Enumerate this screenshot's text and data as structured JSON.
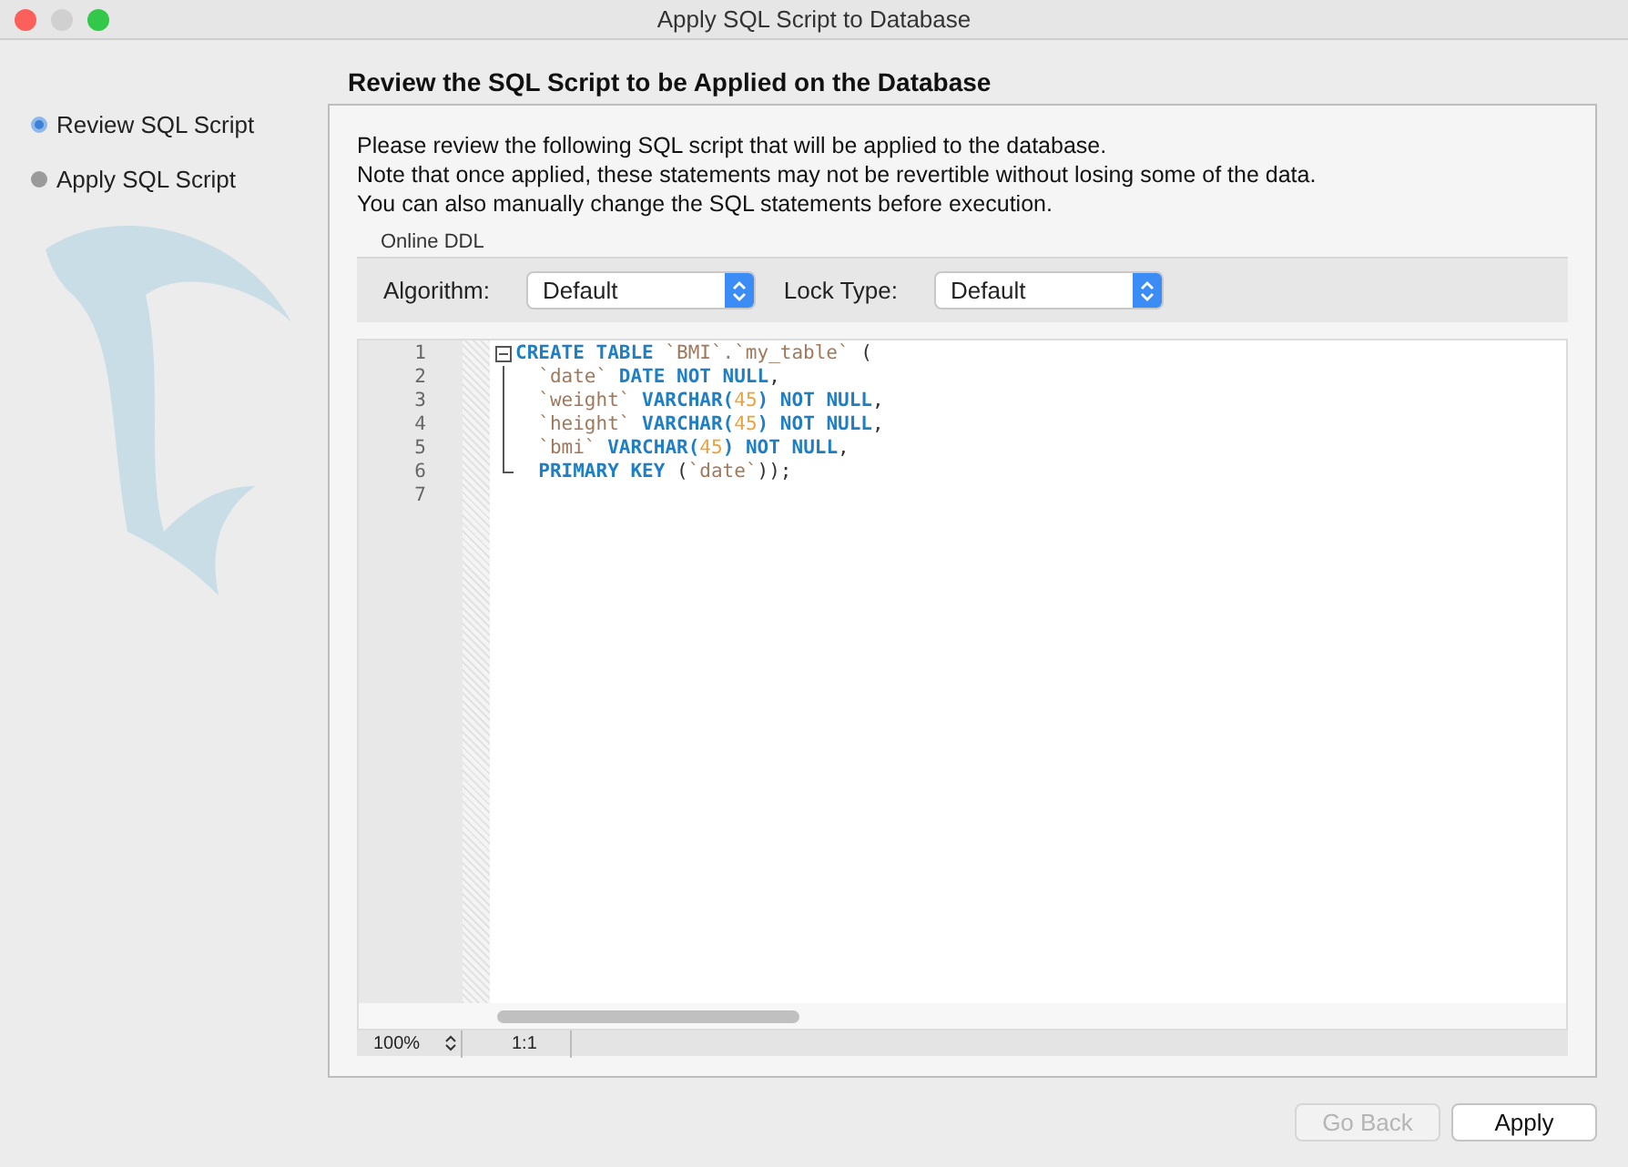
{
  "window": {
    "title": "Apply SQL Script to Database"
  },
  "steps": [
    {
      "label": "Review SQL Script",
      "selected": true
    },
    {
      "label": "Apply SQL Script",
      "selected": false
    }
  ],
  "heading": "Review the SQL Script to be Applied on the Database",
  "description": [
    "Please review the following SQL script that will be applied to the database.",
    "Note that once applied, these statements may not be revertible without losing some of the data.",
    "You can also manually change the SQL statements before execution."
  ],
  "online_ddl": {
    "title": "Online DDL",
    "algorithm": {
      "label": "Algorithm:",
      "value": "Default"
    },
    "lock_type": {
      "label": "Lock Type:",
      "value": "Default"
    }
  },
  "editor": {
    "lines": [
      {
        "number": "1",
        "kind": "open",
        "tokens": [
          {
            "kind": "keyword",
            "text": "CREATE TABLE"
          },
          {
            "kind": "ident",
            "text": " `BMI`.`my_table`"
          },
          {
            "kind": "plain",
            "text": " ("
          }
        ]
      },
      {
        "number": "2",
        "kind": "inner",
        "tokens": [
          {
            "kind": "ident",
            "text": "  `date`"
          },
          {
            "kind": "keyword",
            "text": " DATE NOT NULL"
          },
          {
            "kind": "plain",
            "text": ","
          }
        ]
      },
      {
        "number": "3",
        "kind": "inner",
        "tokens": [
          {
            "kind": "ident",
            "text": "  `weight`"
          },
          {
            "kind": "keyword",
            "text": " VARCHAR("
          },
          {
            "kind": "number",
            "text": "45"
          },
          {
            "kind": "keyword",
            "text": ") NOT NULL"
          },
          {
            "kind": "plain",
            "text": ","
          }
        ]
      },
      {
        "number": "4",
        "kind": "inner",
        "tokens": [
          {
            "kind": "ident",
            "text": "  `height`"
          },
          {
            "kind": "keyword",
            "text": " VARCHAR("
          },
          {
            "kind": "number",
            "text": "45"
          },
          {
            "kind": "keyword",
            "text": ") NOT NULL"
          },
          {
            "kind": "plain",
            "text": ","
          }
        ]
      },
      {
        "number": "5",
        "kind": "inner",
        "tokens": [
          {
            "kind": "ident",
            "text": "  `bmi`"
          },
          {
            "kind": "keyword",
            "text": " VARCHAR("
          },
          {
            "kind": "number",
            "text": "45"
          },
          {
            "kind": "keyword",
            "text": ") NOT NULL"
          },
          {
            "kind": "plain",
            "text": ","
          }
        ]
      },
      {
        "number": "6",
        "kind": "close",
        "tokens": [
          {
            "kind": "keyword",
            "text": "  PRIMARY KEY"
          },
          {
            "kind": "plain",
            "text": " ("
          },
          {
            "kind": "ident",
            "text": "`date`"
          },
          {
            "kind": "plain",
            "text": "));"
          }
        ]
      },
      {
        "number": "7",
        "kind": "plain"
      }
    ],
    "zoom": "100%",
    "position": "1:1"
  },
  "buttons": [
    {
      "label": "Go Back",
      "disabled": true
    },
    {
      "label": "Apply",
      "disabled": false
    }
  ]
}
